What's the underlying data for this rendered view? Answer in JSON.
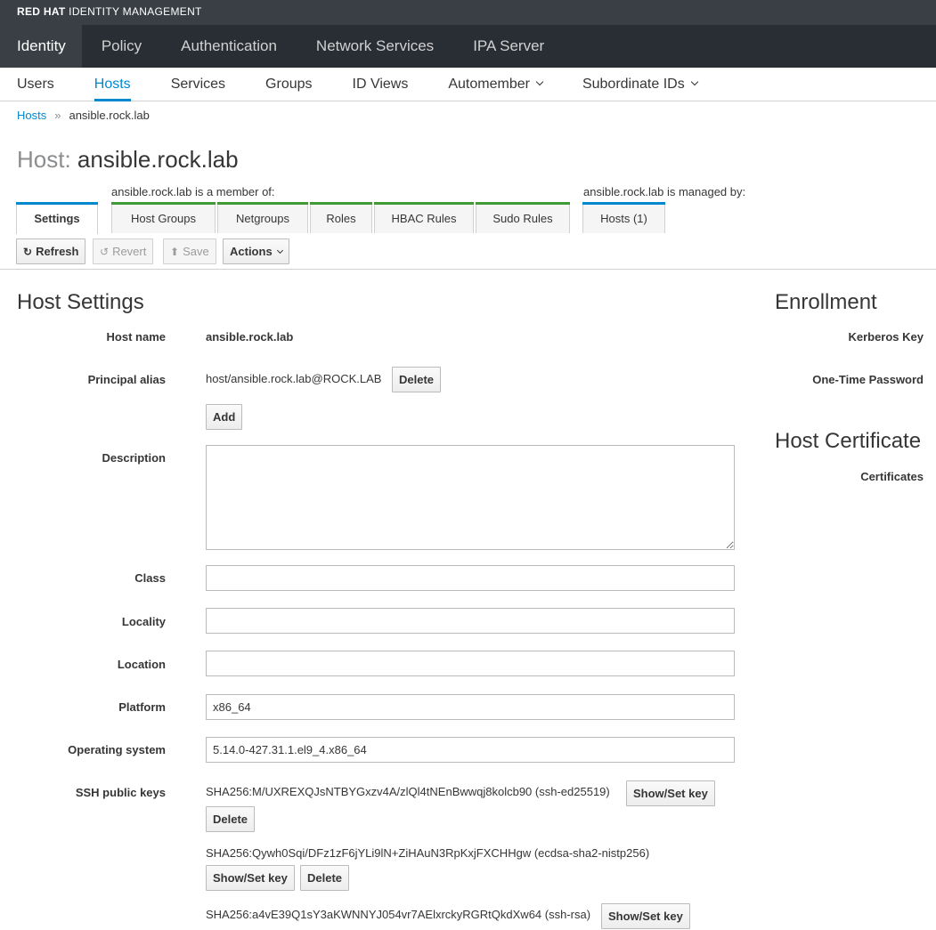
{
  "brand": {
    "bold": "RED HAT",
    "rest": " IDENTITY MANAGEMENT"
  },
  "primary_nav": [
    {
      "label": "Identity",
      "active": true
    },
    {
      "label": "Policy"
    },
    {
      "label": "Authentication"
    },
    {
      "label": "Network Services"
    },
    {
      "label": "IPA Server"
    }
  ],
  "secondary_nav": [
    {
      "label": "Users"
    },
    {
      "label": "Hosts",
      "active": true
    },
    {
      "label": "Services"
    },
    {
      "label": "Groups"
    },
    {
      "label": "ID Views"
    },
    {
      "label": "Automember",
      "dropdown": true
    },
    {
      "label": "Subordinate IDs",
      "dropdown": true
    }
  ],
  "breadcrumb": {
    "parent": "Hosts",
    "separator": "»",
    "current": "ansible.rock.lab"
  },
  "title": {
    "prefix": "Host: ",
    "name": "ansible.rock.lab"
  },
  "facets": {
    "member_caption": "ansible.rock.lab is a member of:",
    "managed_caption": "ansible.rock.lab is managed by:",
    "settings": "Settings",
    "member_tabs": [
      "Host Groups",
      "Netgroups",
      "Roles",
      "HBAC Rules",
      "Sudo Rules"
    ],
    "managed_tabs": [
      "Hosts (1)"
    ]
  },
  "toolbar": {
    "refresh": "Refresh",
    "revert": "Revert",
    "save": "Save",
    "actions": "Actions"
  },
  "host_settings": {
    "title": "Host Settings",
    "host_name_label": "Host name",
    "host_name_value": "ansible.rock.lab",
    "principal_label": "Principal alias",
    "principal_value": "host/ansible.rock.lab@ROCK.LAB",
    "delete": "Delete",
    "add": "Add",
    "description_label": "Description",
    "description_value": "",
    "class_label": "Class",
    "class_value": "",
    "locality_label": "Locality",
    "locality_value": "",
    "location_label": "Location",
    "location_value": "",
    "platform_label": "Platform",
    "platform_value": "x86_64",
    "os_label": "Operating system",
    "os_value": "5.14.0-427.31.1.el9_4.x86_64",
    "ssh_label": "SSH public keys",
    "show_set_key": "Show/Set key",
    "ssh_keys": [
      "SHA256:M/UXREXQJsNTBYGxzv4A/zlQl4tNEnBwwqj8kolcb90 (ssh-ed25519)",
      "SHA256:Qywh0Sqi/DFz1zF6jYLi9lN+ZiHAuN3RpKxjFXCHHgw (ecdsa-sha2-nistp256)",
      "SHA256:a4vE39Q1sY3aKWNNYJ054vr7AElxrckyRGRtQkdXw64 (ssh-rsa)"
    ]
  },
  "enrollment": {
    "title": "Enrollment",
    "kerberos_label": "Kerberos Key",
    "otp_label": "One-Time Password"
  },
  "certificate": {
    "title": "Host Certificate",
    "certificates_label": "Certificates"
  }
}
